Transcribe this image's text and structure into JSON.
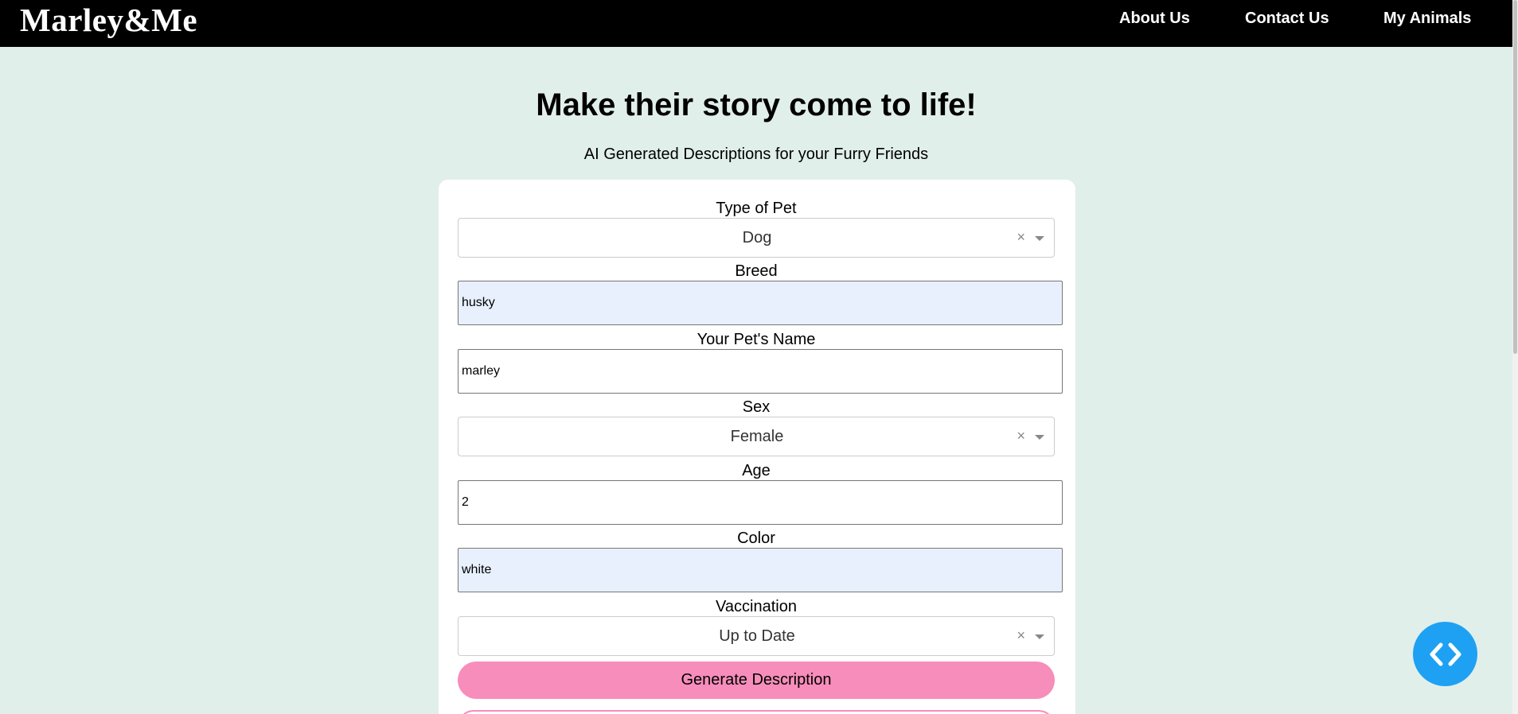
{
  "nav": {
    "brand": "Marley&Me",
    "links": [
      "About Us",
      "Contact Us",
      "My Animals"
    ]
  },
  "hero": {
    "title": "Make their story come to life!",
    "subtitle": "AI Generated Descriptions for your Furry Friends"
  },
  "form": {
    "type_of_pet": {
      "label": "Type of Pet",
      "value": "Dog"
    },
    "breed": {
      "label": "Breed",
      "value": "husky"
    },
    "pet_name": {
      "label": "Your Pet's Name",
      "value": "marley"
    },
    "sex": {
      "label": "Sex",
      "value": "Female"
    },
    "age": {
      "label": "Age",
      "value": "2"
    },
    "color": {
      "label": "Color",
      "value": "white"
    },
    "vaccination": {
      "label": "Vaccination",
      "value": "Up to Date"
    },
    "clear_glyph": "×",
    "submit_label": "Generate Description"
  },
  "icons": {
    "clear": "close-icon",
    "dropdown": "chevron-down-icon",
    "fab": "code-brackets-icon"
  },
  "colors": {
    "navbar": "#000000",
    "page_bg": "#e1efea",
    "button": "#f78dbb",
    "fab": "#1ea1f3",
    "autofill": "#e8f0fe"
  }
}
